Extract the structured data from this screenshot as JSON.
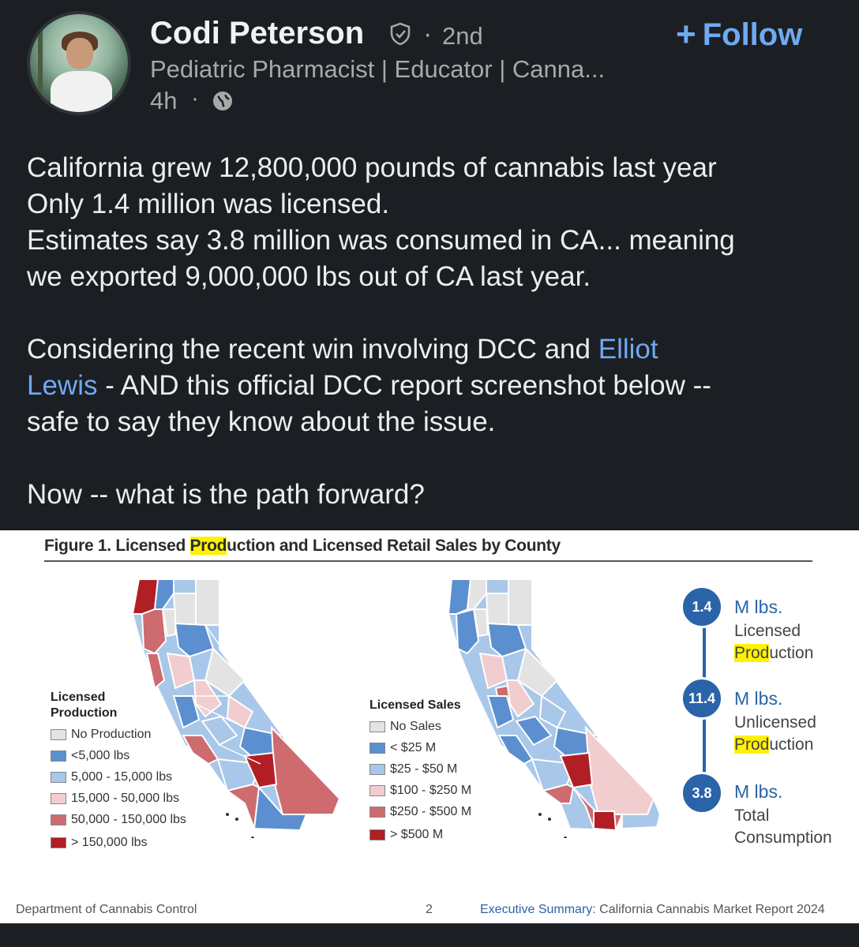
{
  "author": {
    "name": "Codi Peterson",
    "degree": "2nd",
    "headline": "Pediatric Pharmacist | Educator | Canna...",
    "time": "4h",
    "follow_label": "Follow",
    "verified_icon": "verified-shield-icon",
    "visibility_icon": "globe-icon"
  },
  "post": {
    "para1": [
      "California grew 12,800,000 pounds of cannabis last year",
      "Only 1.4 million was licensed.",
      "Estimates say 3.8 million was consumed in CA... meaning",
      "we exported 9,000,000 lbs out of CA last year."
    ],
    "para2_a": "Considering  the recent win involving DCC and ",
    "mention_1": "Elliot",
    "mention_2": "Lewis",
    "para2_b": " - AND this official DCC report screenshot below --",
    "para2_c": "safe to say they know about the issue.",
    "para3": "Now -- what is the path forward?"
  },
  "figure": {
    "title_pre": "Figure 1. Licensed ",
    "title_hl": "Prod",
    "title_post": "uction and Licensed Retail Sales by County",
    "production_legend": {
      "title_line1": "Licensed",
      "title_line2": "Production",
      "items": [
        "No Production",
        "<5,000 lbs",
        "5,000 - 15,000 lbs",
        "15,000 - 50,000 lbs",
        "50,000 - 150,000 lbs",
        "> 150,000 lbs"
      ]
    },
    "sales_legend": {
      "title": "Licensed Sales",
      "items": [
        "No Sales",
        "< $25 M",
        "$25 - $50 M",
        "$100 - $250 M",
        "$250 - $500 M",
        "> $500 M"
      ]
    },
    "colors": [
      "#e3e3e3",
      "#5b8fcf",
      "#a9c7e8",
      "#f2cdcf",
      "#cd6b6f",
      "#b11e24"
    ],
    "stats": [
      {
        "value": "1.4",
        "unit": "M lbs.",
        "label1": "Licensed",
        "label2_hl": "Prod",
        "label2_rest": "uction"
      },
      {
        "value": "11.4",
        "unit": "M lbs.",
        "label1": "Unlicensed",
        "label2_hl": "Prod",
        "label2_rest": "uction"
      },
      {
        "value": "3.8",
        "unit": "M lbs.",
        "label1": "Total",
        "label2_hl": "",
        "label2_rest": "Consumption"
      }
    ],
    "footer_left": "Department of Cannabis Control",
    "footer_page": "2",
    "footer_right_blue": "Executive Summary:",
    "footer_right_rest": " California Cannabis Market Report 2024"
  }
}
